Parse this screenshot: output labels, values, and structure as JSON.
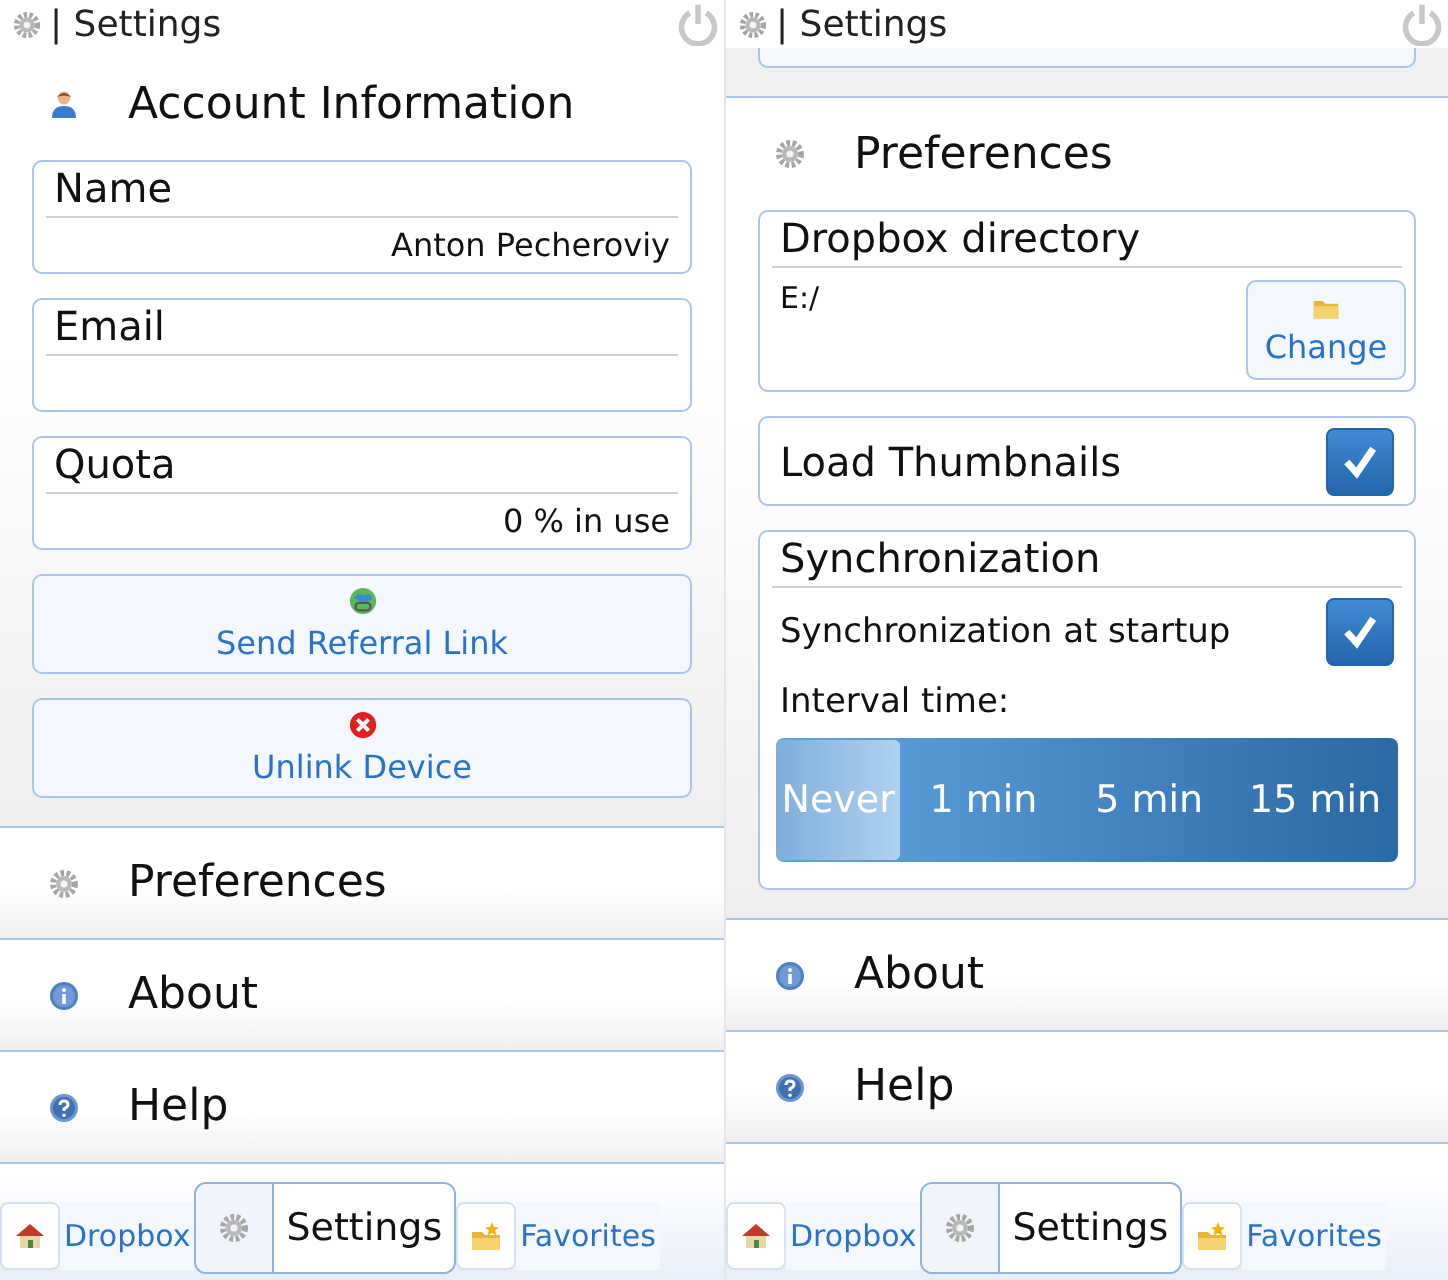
{
  "screens": [
    {
      "title": "| Settings",
      "sections": [
        {
          "label": "Account Information",
          "expanded": true,
          "items": [
            {
              "kind": "field",
              "label": "Name",
              "value": "Anton Pecheroviy"
            },
            {
              "kind": "field",
              "label": "Email"
            },
            {
              "kind": "field",
              "label": "Quota",
              "value": "0 % in use"
            },
            {
              "kind": "button",
              "label": "Send Referral Link"
            },
            {
              "kind": "button",
              "label": "Unlink Device"
            }
          ]
        },
        {
          "label": "Preferences",
          "expanded": false
        },
        {
          "label": "About",
          "expanded": false
        },
        {
          "label": "Help",
          "expanded": false
        }
      ],
      "tabs": [
        {
          "label": "Dropbox",
          "selected": false
        },
        {
          "label": "Settings",
          "selected": true
        },
        {
          "label": "Favorites",
          "selected": false
        }
      ]
    },
    {
      "title": "| Settings",
      "clipped_button_above": true,
      "sections": [
        {
          "label": "Preferences",
          "expanded": true,
          "items": [
            {
              "kind": "directory",
              "label": "Dropbox directory",
              "value": "E:/",
              "button": "Change"
            },
            {
              "kind": "toggle",
              "label": "Load Thumbnails",
              "checked": true
            },
            {
              "kind": "group",
              "label": "Synchronization",
              "items": [
                {
                  "kind": "toggle",
                  "label": "Synchronization at startup",
                  "checked": true
                },
                {
                  "kind": "text",
                  "label": "Interval time:"
                },
                {
                  "kind": "segmented",
                  "options": [
                    {
                      "label": "Never",
                      "selected": true
                    },
                    {
                      "label": "1 min",
                      "selected": false
                    },
                    {
                      "label": "5 min",
                      "selected": false
                    },
                    {
                      "label": "15 min",
                      "selected": false
                    }
                  ]
                }
              ]
            }
          ]
        },
        {
          "label": "About",
          "expanded": false
        },
        {
          "label": "Help",
          "expanded": false
        }
      ],
      "tabs": [
        {
          "label": "Dropbox",
          "selected": false
        },
        {
          "label": "Settings",
          "selected": true
        },
        {
          "label": "Favorites",
          "selected": false
        }
      ]
    }
  ]
}
